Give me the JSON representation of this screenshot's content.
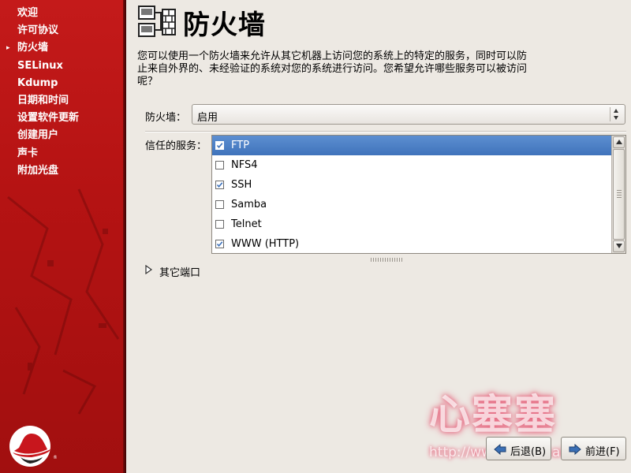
{
  "sidebar": {
    "items": [
      {
        "label": "欢迎"
      },
      {
        "label": "许可协议"
      },
      {
        "label": "防火墙",
        "current": true
      },
      {
        "label": "SELinux"
      },
      {
        "label": "Kdump"
      },
      {
        "label": "日期和时间"
      },
      {
        "label": "设置软件更新"
      },
      {
        "label": "创建用户"
      },
      {
        "label": "声卡"
      },
      {
        "label": "附加光盘"
      }
    ],
    "current_marker": "▸",
    "logo_icon": "redhat-logo-icon"
  },
  "header": {
    "title": "防火墙",
    "icon": "firewall-network-icon"
  },
  "description": "您可以使用一个防火墙来允许从其它机器上访问您的系统上的特定的服务，同时可以防止来自外界的、未经验证的系统对您的系统进行访问。您希望允许哪些服务可以被访问呢？",
  "firewall": {
    "label": "防火墙：",
    "value": "启用"
  },
  "trusted_services": {
    "label": "信任的服务：",
    "items": [
      {
        "name": "FTP",
        "checked": true,
        "selected": true
      },
      {
        "name": "NFS4",
        "checked": false,
        "selected": false
      },
      {
        "name": "SSH",
        "checked": true,
        "selected": false
      },
      {
        "name": "Samba",
        "checked": false,
        "selected": false
      },
      {
        "name": "Telnet",
        "checked": false,
        "selected": false
      },
      {
        "name": "WWW (HTTP)",
        "checked": true,
        "selected": false
      }
    ]
  },
  "other_ports": {
    "label": "其它端口",
    "expanded": false
  },
  "watermark": {
    "text": "心塞塞",
    "url": "http://www.xinsaisai.com"
  },
  "buttons": {
    "back": "后退(B)",
    "next": "前进(F)"
  },
  "colors": {
    "sidebar": "#b51313",
    "selection": "#4a7ec4",
    "background": "#ede9e3"
  }
}
